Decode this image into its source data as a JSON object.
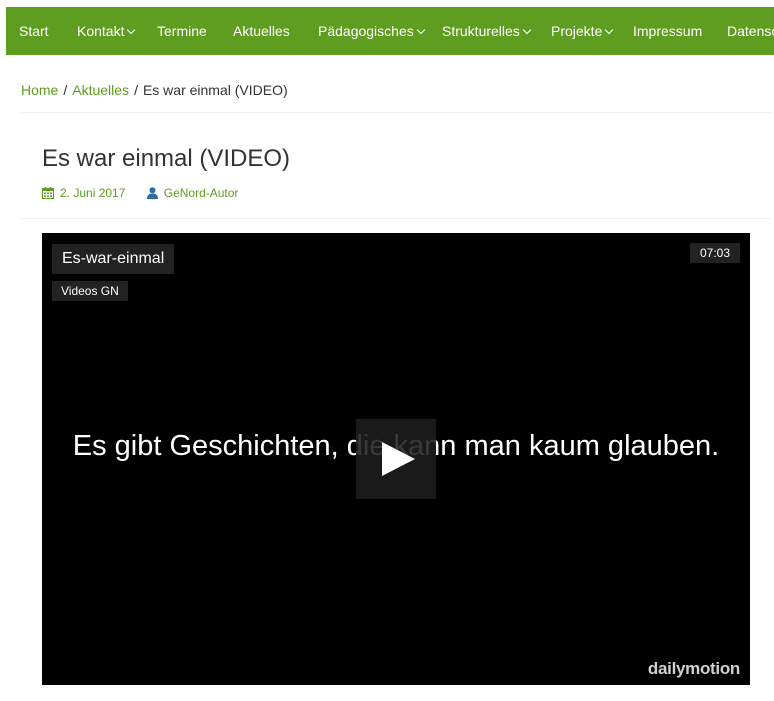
{
  "nav": {
    "items": [
      {
        "label": "Start",
        "dropdown": false
      },
      {
        "label": "Kontakt",
        "dropdown": true
      },
      {
        "label": "Termine",
        "dropdown": false
      },
      {
        "label": "Aktuelles",
        "dropdown": false
      },
      {
        "label": "Pädagogisches",
        "dropdown": true
      },
      {
        "label": "Strukturelles",
        "dropdown": true
      },
      {
        "label": "Projekte",
        "dropdown": true
      },
      {
        "label": "Impressum",
        "dropdown": false
      },
      {
        "label": "Datenschutz",
        "dropdown": false
      }
    ]
  },
  "breadcrumb": {
    "home": "Home",
    "separator": "/",
    "section": "Aktuelles",
    "current": "Es war einmal (VIDEO)"
  },
  "post": {
    "title": "Es war einmal (VIDEO)",
    "date": "2. Juni 2017",
    "date_icon": "calendar-icon",
    "author": "GeNord-Autor",
    "author_icon": "user-icon"
  },
  "video": {
    "title": "Es-war-einmal",
    "channel": "Videos GN",
    "duration": "07:03",
    "caption": "Es gibt Geschichten, die kann man kaum glauben.",
    "play_icon": "play-icon",
    "provider": "dailymotion"
  },
  "colors": {
    "brand_green": "#5e9d1f",
    "video_bg": "#000000"
  }
}
